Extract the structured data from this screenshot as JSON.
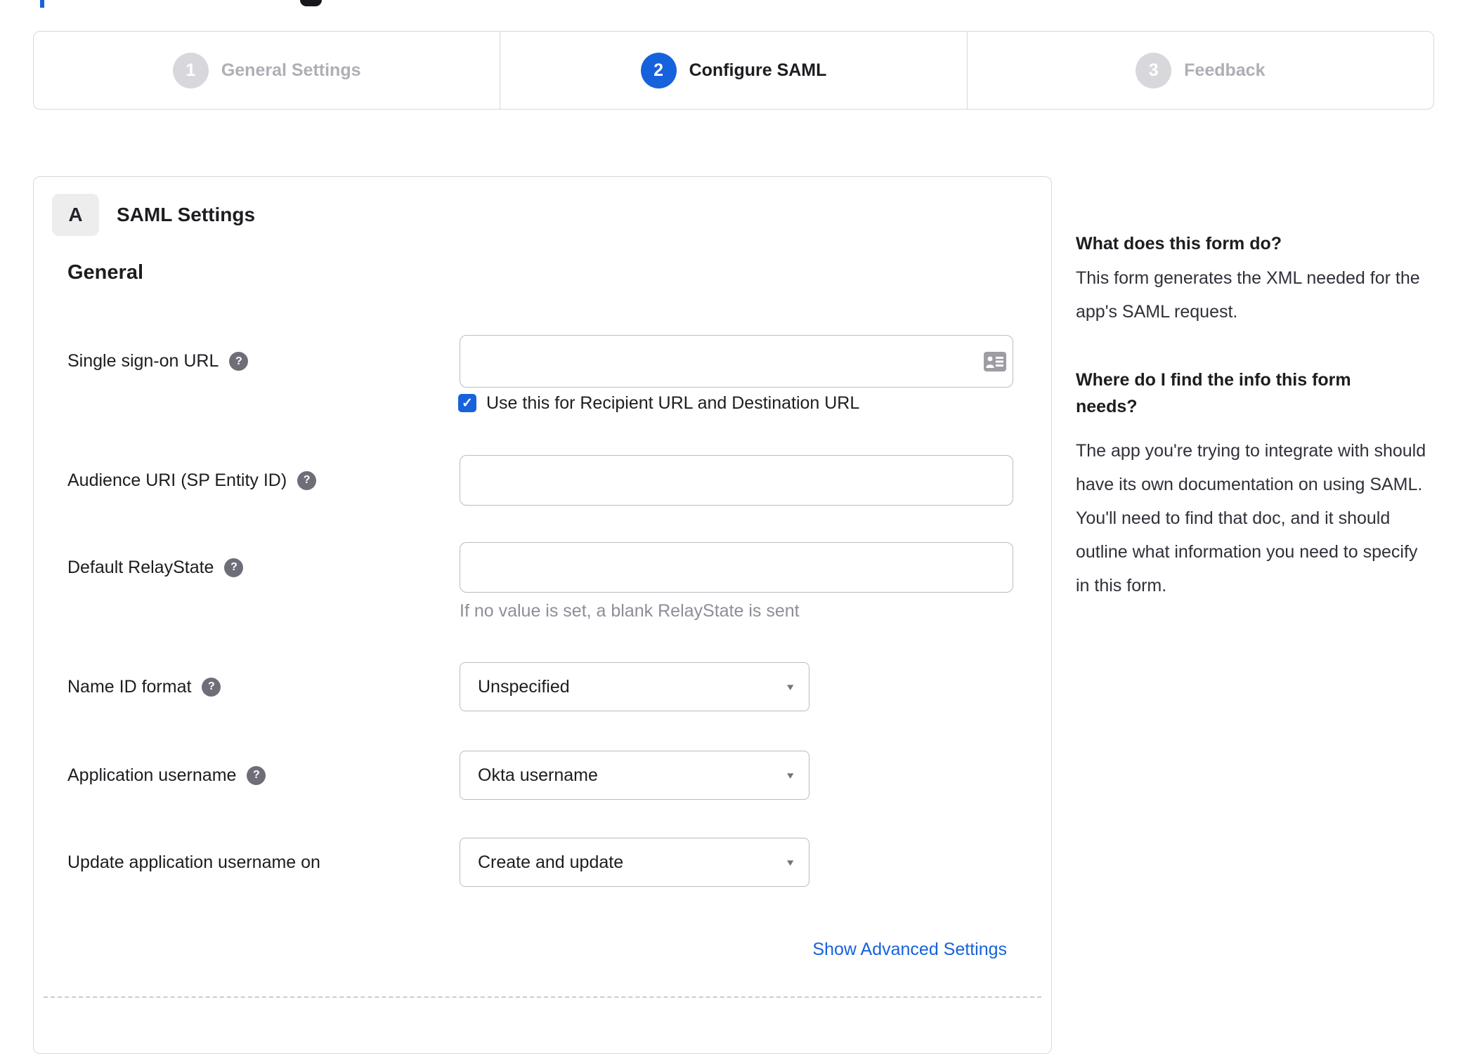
{
  "page": {
    "cutoff_heading_colors": {
      "blue_mark": "#1662dd",
      "text_descender": "#17171c"
    }
  },
  "colors": {
    "accent_blue": "#1662dd",
    "inactive_circle_gray": "#d8d8dc",
    "border_gray": "#d8d8dd",
    "hint_gray": "#8e8e98",
    "help_icon_gray": "#6e6e78"
  },
  "icons": {
    "help_glyph": "?",
    "check_glyph": "✓",
    "select_arrow_glyph": "▾",
    "contact_card_icon": "contact-card"
  },
  "stepper": {
    "steps": [
      {
        "number": "1",
        "label": "General Settings",
        "state": "inactive"
      },
      {
        "number": "2",
        "label": "Configure SAML",
        "state": "active"
      },
      {
        "number": "3",
        "label": "Feedback",
        "state": "inactive"
      }
    ]
  },
  "card": {
    "section_badge": "A",
    "section_title": "SAML Settings",
    "group_heading": "General",
    "fields": {
      "sso": {
        "label": "Single sign-on URL",
        "value": "",
        "has_help": true
      },
      "audience": {
        "label": "Audience URI (SP Entity ID)",
        "value": "",
        "has_help": true
      },
      "relay": {
        "label": "Default RelayState",
        "value": "",
        "has_help": true,
        "hint": "If no value is set, a blank RelayState is sent"
      },
      "nameid": {
        "label": "Name ID format",
        "value": "Unspecified",
        "has_help": true
      },
      "appuser": {
        "label": "Application username",
        "value": "Okta username",
        "has_help": true
      },
      "update": {
        "label": "Update application username on",
        "value": "Create and update",
        "has_help": false
      }
    },
    "checkbox": {
      "checked": true,
      "label": "Use this for Recipient URL and Destination URL"
    },
    "advanced_link_label": "Show Advanced Settings"
  },
  "help_panel": {
    "question_1": "What does this form do?",
    "answer_1": "This form generates the XML needed for the app's SAML request.",
    "question_2": "Where do I find the info this form needs?",
    "answer_2": "The app you're trying to integrate with should have its own documentation on using SAML. You'll need to find that doc, and it should outline what information you need to specify in this form."
  }
}
